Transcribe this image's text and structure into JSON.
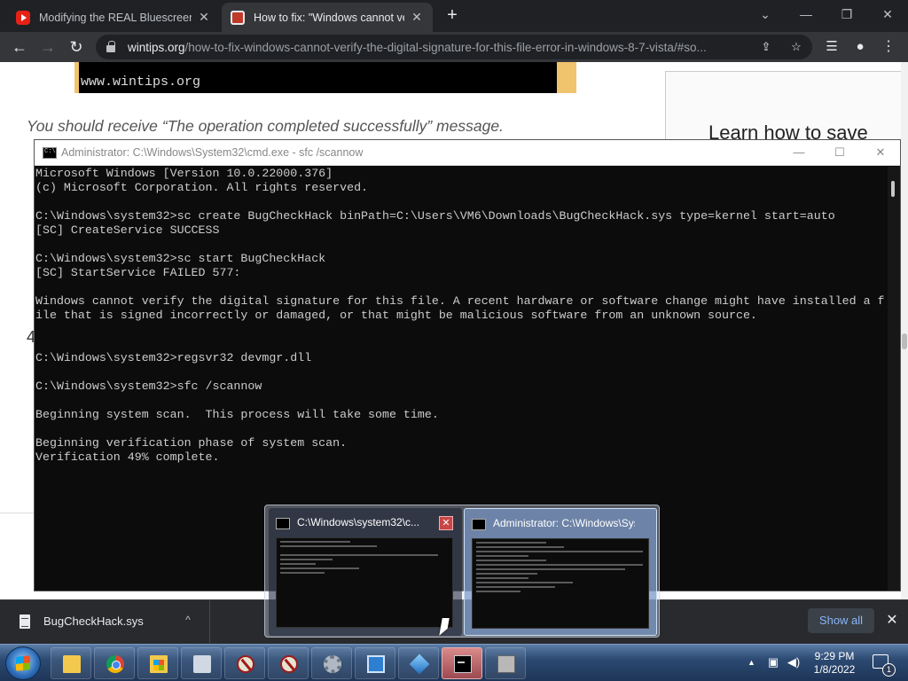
{
  "browser": {
    "tabs": [
      {
        "title": "Modifying the REAL Bluescreen (",
        "favicon": "youtube-icon",
        "active": false
      },
      {
        "title": "How to fix: \"Windows cannot ver",
        "favicon": "wintips-icon",
        "active": true
      }
    ],
    "url_host": "wintips.org",
    "url_path": "/how-to-fix-windows-cannot-verify-the-digital-signature-for-this-file-error-in-windows-8-7-vista/#so..."
  },
  "page": {
    "banner_text": "www.wintips.org",
    "message": "You should receive “The operation completed successfully” message.",
    "ad_text": "Learn how to save",
    "step_digit": "4"
  },
  "cmd": {
    "title": "Administrator: C:\\Windows\\System32\\cmd.exe - sfc  /scannow",
    "lines": [
      "Microsoft Windows [Version 10.0.22000.376]",
      "(c) Microsoft Corporation. All rights reserved.",
      "",
      "C:\\Windows\\system32>sc create BugCheckHack binPath=C:\\Users\\VM6\\Downloads\\BugCheckHack.sys type=kernel start=auto",
      "[SC] CreateService SUCCESS",
      "",
      "C:\\Windows\\system32>sc start BugCheckHack",
      "[SC] StartService FAILED 577:",
      "",
      "Windows cannot verify the digital signature for this file. A recent hardware or software change might have installed a f",
      "ile that is signed incorrectly or damaged, or that might be malicious software from an unknown source.",
      "",
      "",
      "C:\\Windows\\system32>regsvr32 devmgr.dll",
      "",
      "C:\\Windows\\system32>sfc /scannow",
      "",
      "Beginning system scan.  This process will take some time.",
      "",
      "Beginning verification phase of system scan.",
      "Verification 49% complete."
    ]
  },
  "downloads": {
    "file_name": "BugCheckHack.sys",
    "show_all": "Show all"
  },
  "taskbar": {
    "previews": [
      {
        "title": "C:\\Windows\\system32\\c..."
      },
      {
        "title": "Administrator: C:\\Windows\\Sys..."
      }
    ],
    "time": "9:29 PM",
    "date": "1/8/2022",
    "notification_count": "1"
  }
}
